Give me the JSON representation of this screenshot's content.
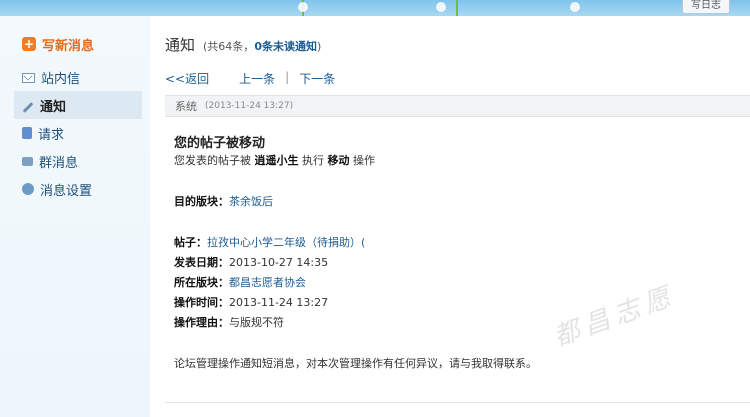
{
  "topbar": {
    "button_label": "写日志"
  },
  "sidebar": {
    "compose_label": "写新消息",
    "items": [
      {
        "label": "站内信",
        "icon": "mail-icon"
      },
      {
        "label": "通知",
        "icon": "pencil-icon",
        "active": true
      },
      {
        "label": "请求",
        "icon": "request-icon"
      },
      {
        "label": "群消息",
        "icon": "group-message-icon"
      },
      {
        "label": "消息设置",
        "icon": "settings-icon"
      }
    ]
  },
  "main": {
    "title": "通知",
    "count_prefix": "(共64条，",
    "unread": "0条未读通知",
    "count_suffix": ")",
    "nav": {
      "back": "<<返回",
      "prev": "上一条",
      "sep": "|",
      "next": "下一条"
    },
    "message": {
      "sender": "系统",
      "time": "(2013-11-24 13:27)",
      "subject": "您的帖子被移动",
      "line1_pre": "您发表的帖子被",
      "line1_user": "逍遥小生",
      "line1_mid": "执行",
      "line1_action": "移动",
      "line1_post": "操作",
      "target_label": "目的版块：",
      "target_value": "茶余饭后",
      "post_label": "帖子：",
      "post_value": "拉孜中心小学二年级（待捐助）(",
      "date_label": "发表日期：",
      "date_value": "2013-10-27 14:35",
      "board_label": "所在版块：",
      "board_value": "都昌志愿者协会",
      "optime_label": "操作时间：",
      "optime_value": "2013-11-24 13:27",
      "reason_label": "操作理由：",
      "reason_value": "与版规不符",
      "footer": "论坛管理操作通知短消息，对本次管理操作有任何异议，请与我取得联系。"
    }
  },
  "watermark": "都昌志愿"
}
